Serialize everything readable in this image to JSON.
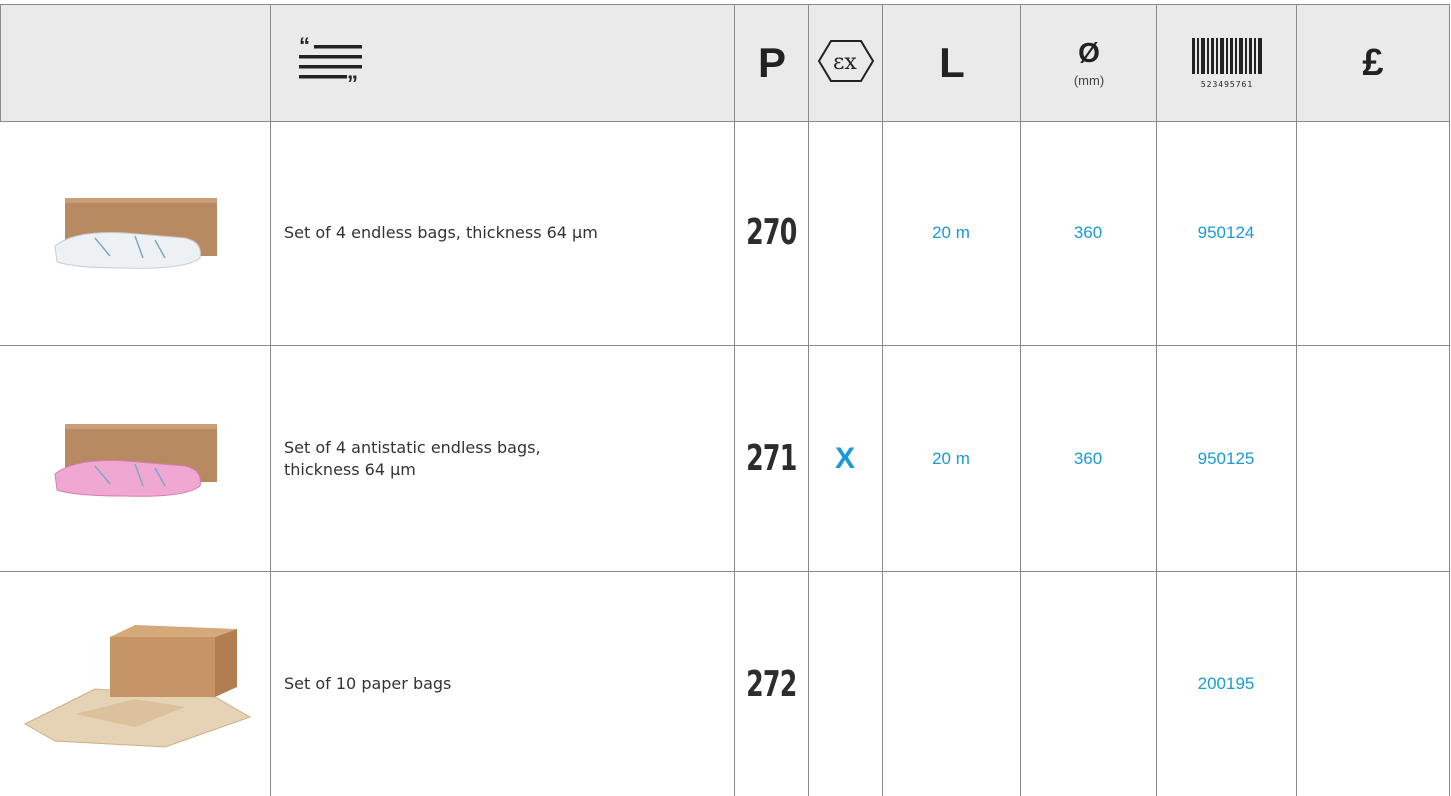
{
  "header": {
    "description_icon": "quote-lines-icon",
    "col_p": "P",
    "col_ex_icon": "atex-ex-icon",
    "col_ex_text": "εx",
    "col_length": "L",
    "col_diameter": "Ø",
    "col_diameter_unit": "(mm)",
    "col_barcode_icon": "barcode-icon",
    "col_barcode_number": "523495761",
    "col_price": "£"
  },
  "rows": [
    {
      "image_icon": "box-with-white-bags-image",
      "description": "Set of 4 endless bags, thickness 64 µm",
      "p": "270",
      "ex": "",
      "length": "20 m",
      "diameter": "360",
      "code": "950124",
      "price": ""
    },
    {
      "image_icon": "box-with-pink-bags-image",
      "description": "Set of 4 antistatic endless bags, thickness 64 µm",
      "p": "271",
      "ex": "X",
      "length": "20 m",
      "diameter": "360",
      "code": "950125",
      "price": ""
    },
    {
      "image_icon": "box-with-paper-bags-image",
      "description": "Set of 10 paper bags",
      "p": "272",
      "ex": "",
      "length": "",
      "diameter": "",
      "code": "200195",
      "price": ""
    }
  ],
  "colors": {
    "accent_blue": "#1a9ad6",
    "header_bg": "#eaeaea",
    "grid_line": "#8a8a8a"
  }
}
